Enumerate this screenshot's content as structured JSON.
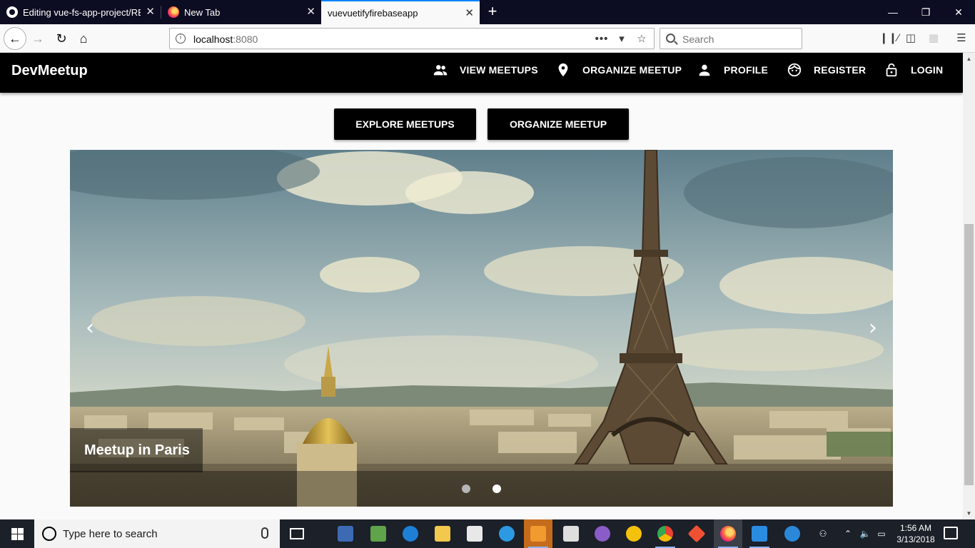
{
  "browser": {
    "tabs": [
      {
        "label": "Editing vue-fs-app-project/REA",
        "icon": "github-icon",
        "active": false
      },
      {
        "label": "New Tab",
        "icon": "firefox-icon",
        "active": false
      },
      {
        "label": "vuevuetifyfirebaseapp",
        "icon": "",
        "active": true
      }
    ],
    "new_tab_label": "+",
    "url_host": "localhost",
    "url_port": ":8080",
    "search_placeholder": "Search",
    "window_controls": {
      "minimize": "—",
      "restore": "❐",
      "close": "✕"
    }
  },
  "app": {
    "brand": "DevMeetup",
    "nav": [
      {
        "label": "VIEW MEETUPS",
        "icon": "people-icon"
      },
      {
        "label": "ORGANIZE MEETUP",
        "icon": "location-pin-icon"
      },
      {
        "label": "PROFILE",
        "icon": "person-icon"
      },
      {
        "label": "REGISTER",
        "icon": "face-icon"
      },
      {
        "label": "LOGIN",
        "icon": "lock-open-icon"
      }
    ],
    "cta": {
      "explore": "EXPLORE MEETUPS",
      "organize": "ORGANIZE MEETUP"
    },
    "carousel": {
      "caption": "Meetup in Paris",
      "prev_glyph": "‹",
      "next_glyph": "›",
      "slides": 2,
      "active_slide": 2
    }
  },
  "taskbar": {
    "search_placeholder": "Type here to search",
    "time": "1:56 AM",
    "date": "3/13/2018"
  },
  "colors": {
    "tabstrip": "#0c0c22",
    "app_bar": "#000000",
    "accent": "#0a84ff",
    "taskbar": "#1b2029"
  }
}
